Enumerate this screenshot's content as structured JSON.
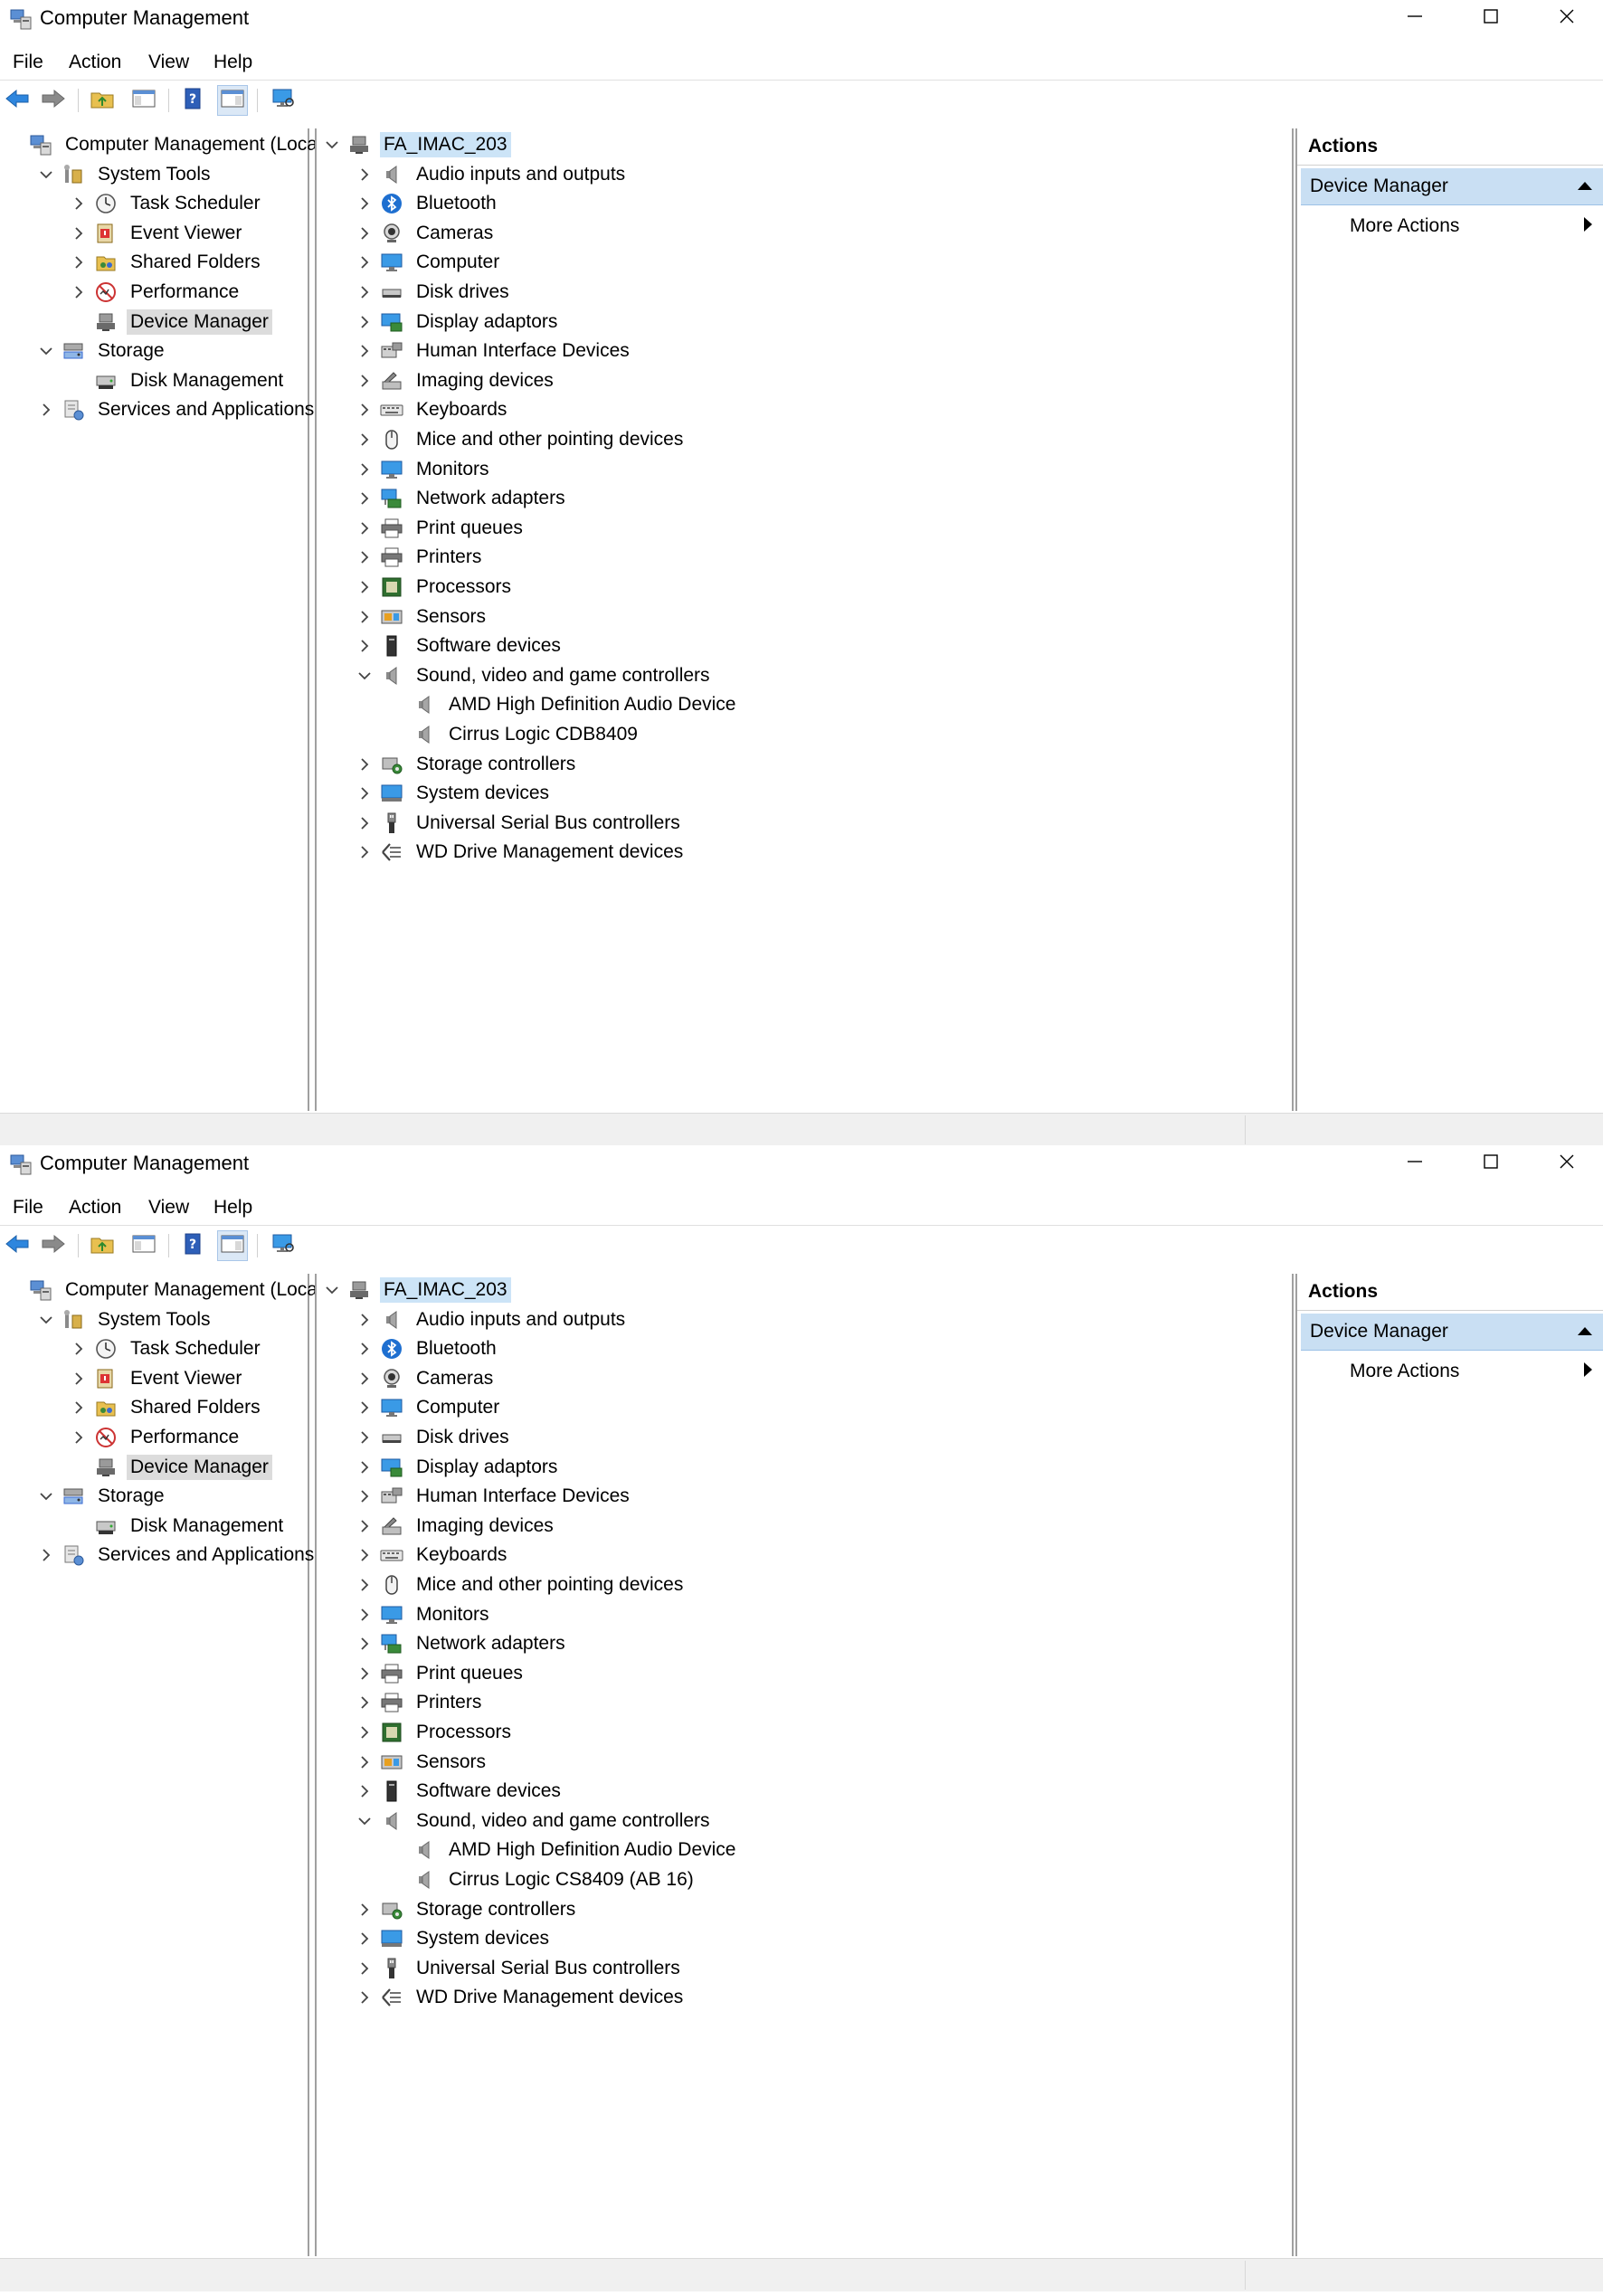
{
  "windows": [
    {
      "title": "Computer Management",
      "menu": [
        "File",
        "Action",
        "View",
        "Help"
      ],
      "left_tree": [
        {
          "label": "Computer Management (Local)",
          "level": 0,
          "expander": "none",
          "icon": "computer-management-icon"
        },
        {
          "label": "System Tools",
          "level": 1,
          "expander": "expanded",
          "icon": "system-tools-icon"
        },
        {
          "label": "Task Scheduler",
          "level": 2,
          "expander": "collapsed",
          "icon": "clock-icon"
        },
        {
          "label": "Event Viewer",
          "level": 2,
          "expander": "collapsed",
          "icon": "event-viewer-icon"
        },
        {
          "label": "Shared Folders",
          "level": 2,
          "expander": "collapsed",
          "icon": "shared-folders-icon"
        },
        {
          "label": "Performance",
          "level": 2,
          "expander": "collapsed",
          "icon": "performance-icon"
        },
        {
          "label": "Device Manager",
          "level": 2,
          "expander": "none",
          "icon": "device-manager-icon",
          "selected": true
        },
        {
          "label": "Storage",
          "level": 1,
          "expander": "expanded",
          "icon": "storage-icon"
        },
        {
          "label": "Disk Management",
          "level": 2,
          "expander": "none",
          "icon": "disk-management-icon"
        },
        {
          "label": "Services and Applications",
          "level": 1,
          "expander": "collapsed",
          "icon": "services-icon"
        }
      ],
      "device_tree": [
        {
          "label": "FA_IMAC_203",
          "level": 0,
          "expander": "expanded",
          "icon": "computer-root-icon",
          "root": true
        },
        {
          "label": "Audio inputs and outputs",
          "level": 1,
          "expander": "collapsed",
          "icon": "speaker-icon"
        },
        {
          "label": "Bluetooth",
          "level": 1,
          "expander": "collapsed",
          "icon": "bluetooth-icon"
        },
        {
          "label": "Cameras",
          "level": 1,
          "expander": "collapsed",
          "icon": "camera-icon"
        },
        {
          "label": "Computer",
          "level": 1,
          "expander": "collapsed",
          "icon": "monitor-icon"
        },
        {
          "label": "Disk drives",
          "level": 1,
          "expander": "collapsed",
          "icon": "disk-drive-icon"
        },
        {
          "label": "Display adaptors",
          "level": 1,
          "expander": "collapsed",
          "icon": "display-adapter-icon"
        },
        {
          "label": "Human Interface Devices",
          "level": 1,
          "expander": "collapsed",
          "icon": "hid-icon"
        },
        {
          "label": "Imaging devices",
          "level": 1,
          "expander": "collapsed",
          "icon": "scanner-icon"
        },
        {
          "label": "Keyboards",
          "level": 1,
          "expander": "collapsed",
          "icon": "keyboard-icon"
        },
        {
          "label": "Mice and other pointing devices",
          "level": 1,
          "expander": "collapsed",
          "icon": "mouse-icon"
        },
        {
          "label": "Monitors",
          "level": 1,
          "expander": "collapsed",
          "icon": "monitor-icon"
        },
        {
          "label": "Network adapters",
          "level": 1,
          "expander": "collapsed",
          "icon": "network-icon"
        },
        {
          "label": "Print queues",
          "level": 1,
          "expander": "collapsed",
          "icon": "printer-icon"
        },
        {
          "label": "Printers",
          "level": 1,
          "expander": "collapsed",
          "icon": "printer-icon"
        },
        {
          "label": "Processors",
          "level": 1,
          "expander": "collapsed",
          "icon": "processor-icon"
        },
        {
          "label": "Sensors",
          "level": 1,
          "expander": "collapsed",
          "icon": "sensor-icon"
        },
        {
          "label": "Software devices",
          "level": 1,
          "expander": "collapsed",
          "icon": "software-device-icon"
        },
        {
          "label": "Sound, video and game controllers",
          "level": 1,
          "expander": "expanded",
          "icon": "speaker-icon"
        },
        {
          "label": "AMD High Definition Audio Device",
          "level": 2,
          "expander": "none",
          "icon": "speaker-icon"
        },
        {
          "label": "Cirrus Logic CDB8409",
          "level": 2,
          "expander": "none",
          "icon": "speaker-icon"
        },
        {
          "label": "Storage controllers",
          "level": 1,
          "expander": "collapsed",
          "icon": "storage-controller-icon"
        },
        {
          "label": "System devices",
          "level": 1,
          "expander": "collapsed",
          "icon": "system-device-icon"
        },
        {
          "label": "Universal Serial Bus controllers",
          "level": 1,
          "expander": "collapsed",
          "icon": "usb-icon"
        },
        {
          "label": "WD Drive Management devices",
          "level": 1,
          "expander": "collapsed",
          "icon": "wd-device-icon"
        }
      ],
      "actions": {
        "title": "Actions",
        "section": "Device Manager",
        "more": "More Actions"
      }
    },
    {
      "title": "Computer Management",
      "menu": [
        "File",
        "Action",
        "View",
        "Help"
      ],
      "left_tree": [
        {
          "label": "Computer Management (Local)",
          "level": 0,
          "expander": "none",
          "icon": "computer-management-icon"
        },
        {
          "label": "System Tools",
          "level": 1,
          "expander": "expanded",
          "icon": "system-tools-icon"
        },
        {
          "label": "Task Scheduler",
          "level": 2,
          "expander": "collapsed",
          "icon": "clock-icon"
        },
        {
          "label": "Event Viewer",
          "level": 2,
          "expander": "collapsed",
          "icon": "event-viewer-icon"
        },
        {
          "label": "Shared Folders",
          "level": 2,
          "expander": "collapsed",
          "icon": "shared-folders-icon"
        },
        {
          "label": "Performance",
          "level": 2,
          "expander": "collapsed",
          "icon": "performance-icon"
        },
        {
          "label": "Device Manager",
          "level": 2,
          "expander": "none",
          "icon": "device-manager-icon",
          "selected": true
        },
        {
          "label": "Storage",
          "level": 1,
          "expander": "expanded",
          "icon": "storage-icon"
        },
        {
          "label": "Disk Management",
          "level": 2,
          "expander": "none",
          "icon": "disk-management-icon"
        },
        {
          "label": "Services and Applications",
          "level": 1,
          "expander": "collapsed",
          "icon": "services-icon"
        }
      ],
      "device_tree": [
        {
          "label": "FA_IMAC_203",
          "level": 0,
          "expander": "expanded",
          "icon": "computer-root-icon",
          "root": true
        },
        {
          "label": "Audio inputs and outputs",
          "level": 1,
          "expander": "collapsed",
          "icon": "speaker-icon"
        },
        {
          "label": "Bluetooth",
          "level": 1,
          "expander": "collapsed",
          "icon": "bluetooth-icon"
        },
        {
          "label": "Cameras",
          "level": 1,
          "expander": "collapsed",
          "icon": "camera-icon"
        },
        {
          "label": "Computer",
          "level": 1,
          "expander": "collapsed",
          "icon": "monitor-icon"
        },
        {
          "label": "Disk drives",
          "level": 1,
          "expander": "collapsed",
          "icon": "disk-drive-icon"
        },
        {
          "label": "Display adaptors",
          "level": 1,
          "expander": "collapsed",
          "icon": "display-adapter-icon"
        },
        {
          "label": "Human Interface Devices",
          "level": 1,
          "expander": "collapsed",
          "icon": "hid-icon"
        },
        {
          "label": "Imaging devices",
          "level": 1,
          "expander": "collapsed",
          "icon": "scanner-icon"
        },
        {
          "label": "Keyboards",
          "level": 1,
          "expander": "collapsed",
          "icon": "keyboard-icon"
        },
        {
          "label": "Mice and other pointing devices",
          "level": 1,
          "expander": "collapsed",
          "icon": "mouse-icon"
        },
        {
          "label": "Monitors",
          "level": 1,
          "expander": "collapsed",
          "icon": "monitor-icon"
        },
        {
          "label": "Network adapters",
          "level": 1,
          "expander": "collapsed",
          "icon": "network-icon"
        },
        {
          "label": "Print queues",
          "level": 1,
          "expander": "collapsed",
          "icon": "printer-icon"
        },
        {
          "label": "Printers",
          "level": 1,
          "expander": "collapsed",
          "icon": "printer-icon"
        },
        {
          "label": "Processors",
          "level": 1,
          "expander": "collapsed",
          "icon": "processor-icon"
        },
        {
          "label": "Sensors",
          "level": 1,
          "expander": "collapsed",
          "icon": "sensor-icon"
        },
        {
          "label": "Software devices",
          "level": 1,
          "expander": "collapsed",
          "icon": "software-device-icon"
        },
        {
          "label": "Sound, video and game controllers",
          "level": 1,
          "expander": "expanded",
          "icon": "speaker-icon"
        },
        {
          "label": "AMD High Definition Audio Device",
          "level": 2,
          "expander": "none",
          "icon": "speaker-icon"
        },
        {
          "label": "Cirrus Logic CS8409 (AB 16)",
          "level": 2,
          "expander": "none",
          "icon": "speaker-icon"
        },
        {
          "label": "Storage controllers",
          "level": 1,
          "expander": "collapsed",
          "icon": "storage-controller-icon"
        },
        {
          "label": "System devices",
          "level": 1,
          "expander": "collapsed",
          "icon": "system-device-icon"
        },
        {
          "label": "Universal Serial Bus controllers",
          "level": 1,
          "expander": "collapsed",
          "icon": "usb-icon"
        },
        {
          "label": "WD Drive Management devices",
          "level": 1,
          "expander": "collapsed",
          "icon": "wd-device-icon"
        }
      ],
      "actions": {
        "title": "Actions",
        "section": "Device Manager",
        "more": "More Actions"
      }
    }
  ],
  "colors": {
    "selection_gray": "#dcdcdc",
    "root_highlight": "#cce4f7",
    "actions_header": "#c9dff3",
    "pane_border": "#a0a0a0",
    "status_bar": "#f0f0f0"
  }
}
